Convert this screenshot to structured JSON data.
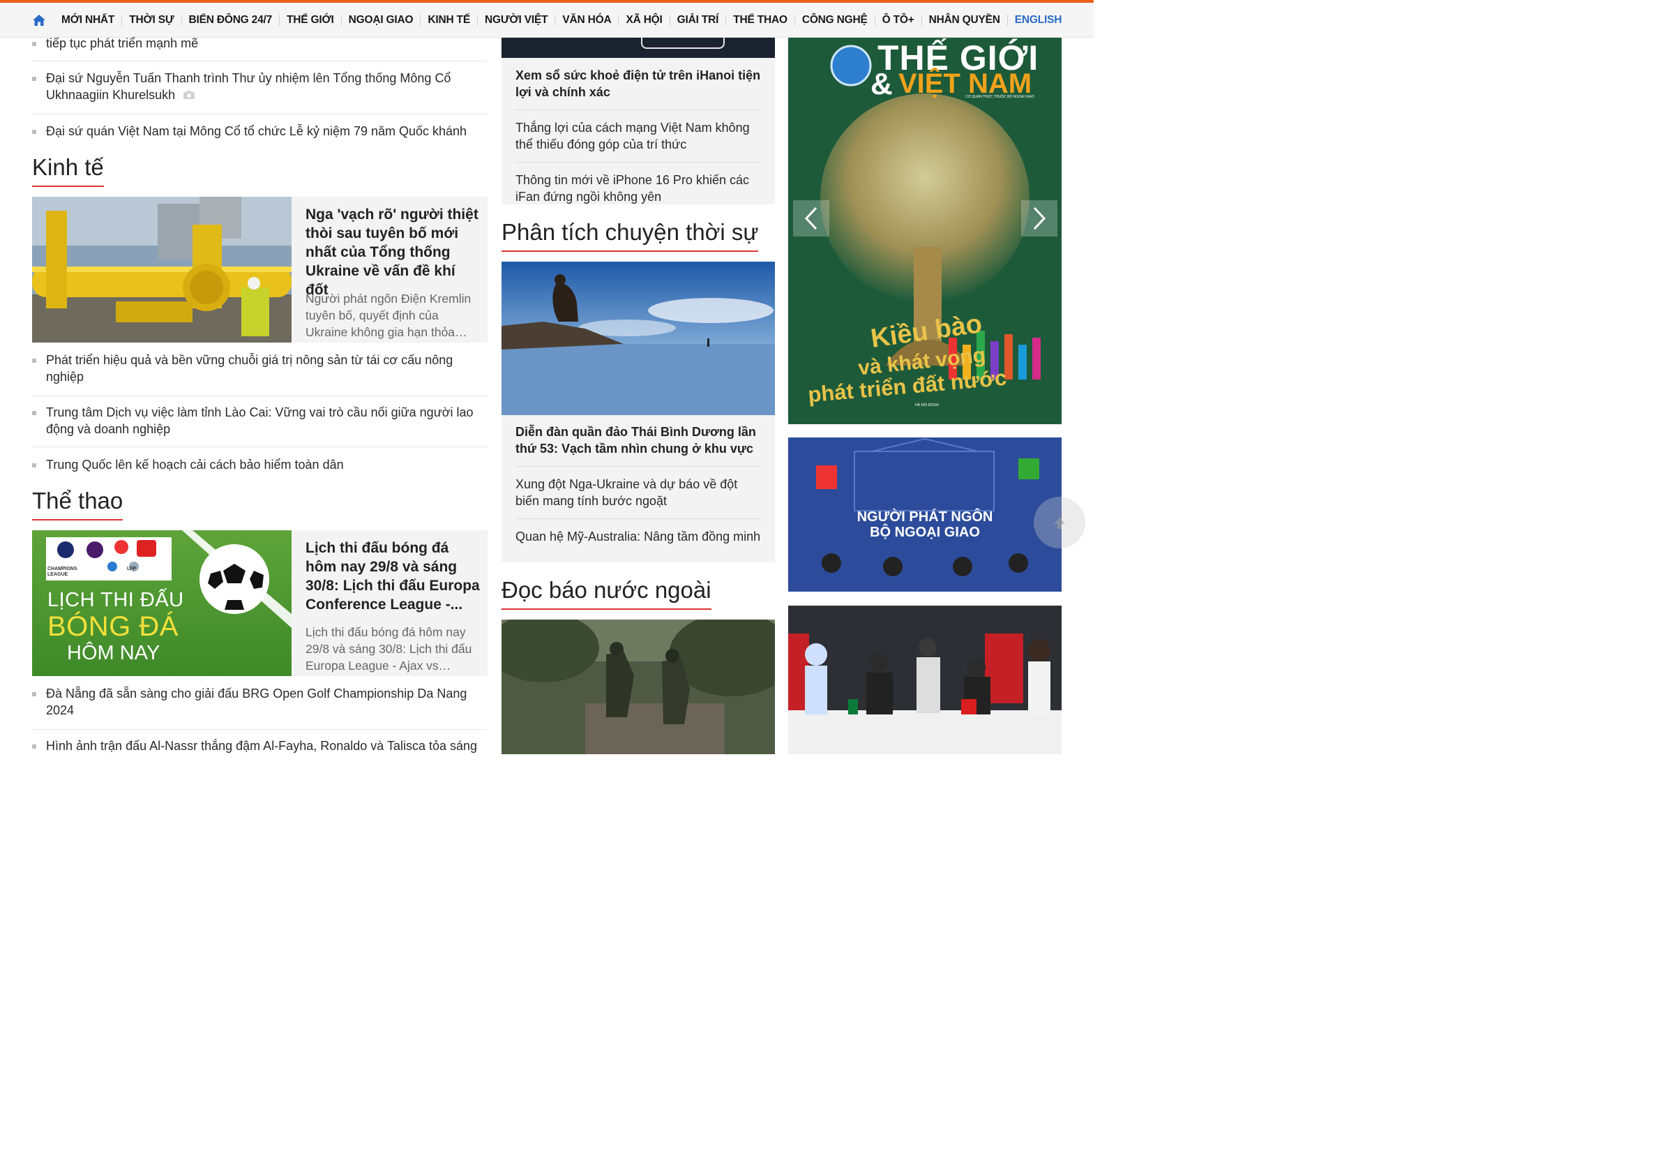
{
  "nav": {
    "items": [
      "MỚI NHẤT",
      "THỜI SỰ",
      "BIỂN ĐÔNG 24/7",
      "THẾ GIỚI",
      "NGOẠI GIAO",
      "KINH TẾ",
      "NGƯỜI VIỆT",
      "VĂN HÓA",
      "XÃ HỘI",
      "GIẢI TRÍ",
      "THỂ THAO",
      "CÔNG NGHỆ",
      "Ô TÔ+",
      "NHÂN QUYỀN",
      "ENGLISH"
    ]
  },
  "left_top": {
    "partial": "tiếp tục phát triển mạnh mẽ",
    "items": [
      "Đại sứ Nguyễn Tuấn Thanh trình Thư ủy nhiệm lên Tổng thống Mông Cổ Ukhnaagiin Khurelsukh",
      "Đại sứ quán Việt Nam tại Mông Cổ tổ chức Lễ kỷ niệm 79 năm Quốc khánh"
    ]
  },
  "kinh_te": {
    "title": "Kinh tế",
    "feature_title": "Nga 'vạch rõ' người thiệt thòi sau tuyên bố mới nhất của Tổng thống Ukraine về vấn đề khí đốt",
    "feature_desc": "Người phát ngôn Điện Kremlin tuyên bố, quyết định của Ukraine không gia hạn thỏa…",
    "items": [
      "Phát triển hiệu quả và bền vững chuỗi giá trị nông sản từ tái cơ cấu nông nghiệp",
      "Trung tâm Dịch vụ việc làm tỉnh Lào Cai: Vững vai trò cầu nối giữa người lao động và doanh nghiệp",
      "Trung Quốc lên kế hoạch cải cách bảo hiểm toàn dân"
    ]
  },
  "the_thao": {
    "title": "Thể thao",
    "feature_title": "Lịch thi đấu bóng đá hôm nay 29/8 và sáng 30/8: Lịch thi đấu Europa Conference League -...",
    "feature_desc": "Lịch thi đấu bóng đá hôm nay 29/8 và sáng 30/8: Lịch thi đấu Europa League - Ajax vs…",
    "img_text": [
      "LỊCH THI ĐẤU",
      "BÓNG ĐÁ",
      "HÔM NAY"
    ],
    "img_logos": [
      "CHAMPIONS LEAGUE",
      "PREMIER LEAGUE",
      "LFP",
      "BUNDESLIGA",
      "SERIE A",
      "LIGUE 1"
    ],
    "items": [
      "Đà Nẵng đã sẵn sàng cho giải đấu BRG Open Golf Championship Da Nang 2024",
      "Hình ảnh trận đấu Al-Nassr thắng đậm Al-Fayha, Ronaldo và Talisca tỏa sáng"
    ]
  },
  "mid_top": {
    "items": [
      "Xem sổ sức khoẻ điện tử trên iHanoi tiện lợi và chính xác",
      "Thắng lợi của cách mạng Việt Nam không thể thiếu đóng góp của trí thức",
      "Thông tin mới về iPhone 16 Pro khiến các iFan đứng ngồi không yên"
    ]
  },
  "phan_tich": {
    "title": "Phân tích chuyện thời sự",
    "items": [
      "Diễn đàn quần đảo Thái Bình Dương lần thứ 53: Vạch tầm nhìn chung ở khu vực",
      "Xung đột Nga-Ukraine và dự báo về đột biến mang tính bước ngoặt",
      "Quan hệ Mỹ-Australia: Nâng tầm đồng minh"
    ]
  },
  "doc_bao": {
    "title": "Đọc báo nước ngoài"
  },
  "banners": {
    "magazine_line1": "THẾ GIỚI",
    "magazine_amp": "&",
    "magazine_line2": "VIỆT NAM",
    "magazine_sub": "CƠ QUAN TRỰC THUỘC BỘ NGOẠI GIAO",
    "magazine_cover1": "Kiều bào",
    "magazine_cover2": "và khát vọng",
    "magazine_cover3": "phát triển đất nước",
    "magazine_date": "HÀ NỘI 8/2024",
    "spokesperson_line1": "NGƯỜI PHÁT NGÔN",
    "spokesperson_line2": "BỘ NGOẠI GIAO"
  },
  "colors": {
    "accent_orange": "#e8611c",
    "section_underline": "#dd3333",
    "english_link": "#2a6bc7"
  }
}
